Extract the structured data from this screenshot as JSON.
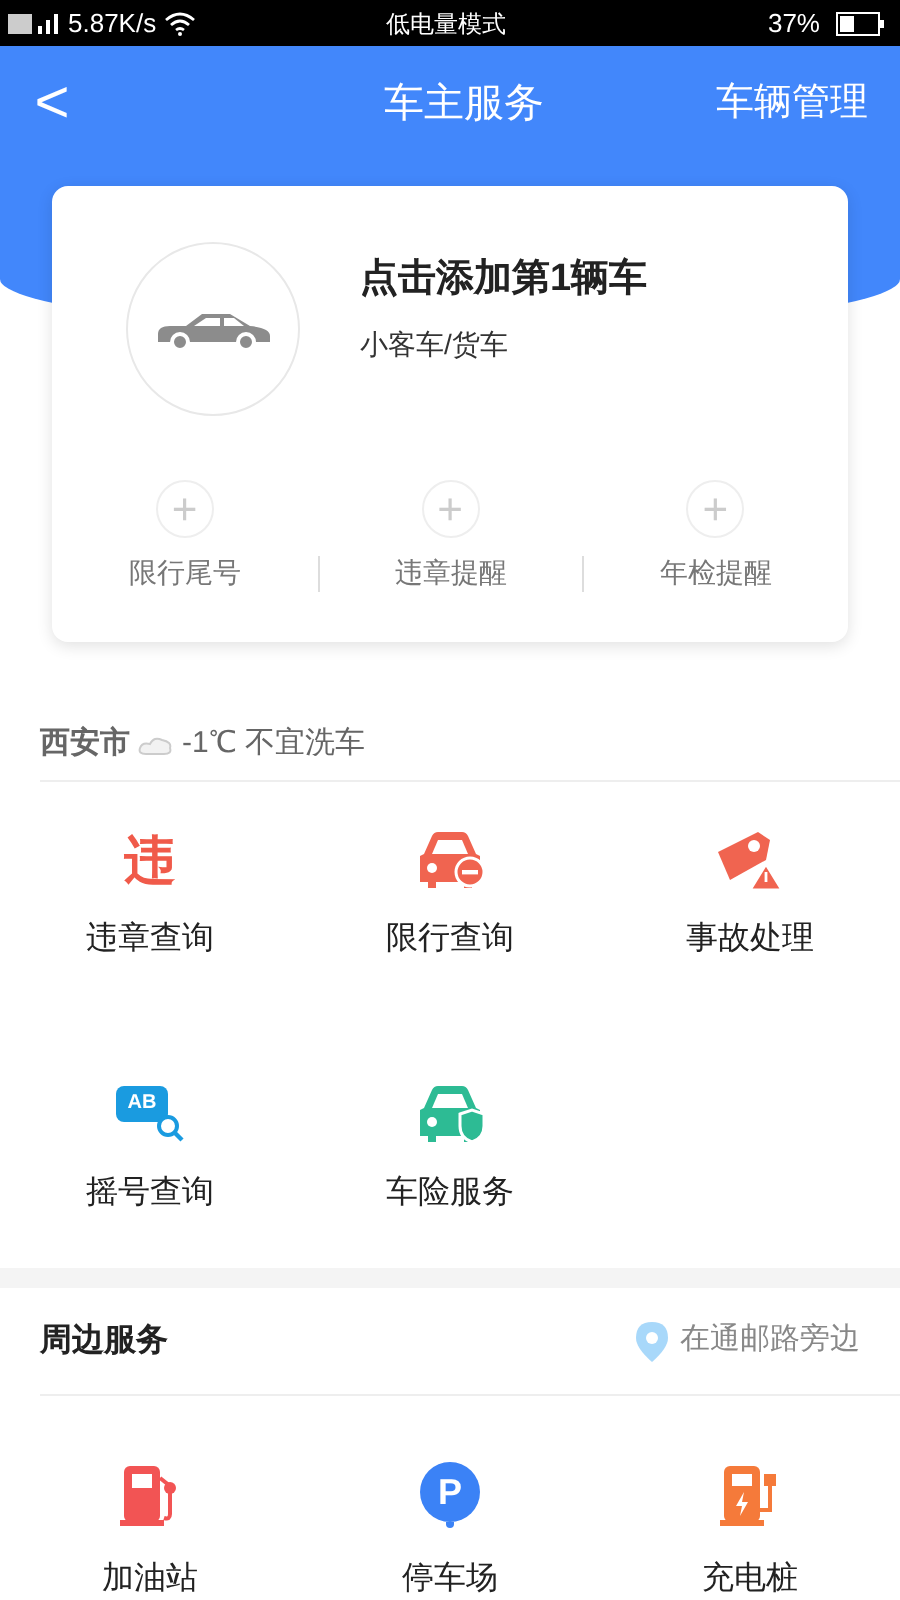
{
  "status_bar": {
    "speed": "5.87K/s",
    "mode": "低电量模式",
    "battery": "37%"
  },
  "header": {
    "back": "<",
    "title": "车主服务",
    "action": "车辆管理"
  },
  "vehicle_card": {
    "title": "点击添加第1辆车",
    "subtitle": "小客车/货车",
    "shortcuts": [
      {
        "plus": "+",
        "label": "限行尾号"
      },
      {
        "plus": "+",
        "label": "违章提醒"
      },
      {
        "plus": "+",
        "label": "年检提醒"
      }
    ]
  },
  "weather": {
    "city": "西安市",
    "temp": "-1℃",
    "advice": "不宜洗车"
  },
  "services": [
    {
      "kind": "violation",
      "glyph": "违",
      "label": "违章查询"
    },
    {
      "kind": "restriction",
      "label": "限行查询"
    },
    {
      "kind": "accident",
      "label": "事故处理"
    },
    {
      "kind": "lottery",
      "glyph": "AB",
      "label": "摇号查询"
    },
    {
      "kind": "insurance",
      "label": "车险服务"
    }
  ],
  "nearby": {
    "title": "周边服务",
    "location": "在通邮路旁边",
    "items": [
      {
        "kind": "fuel",
        "label": "加油站"
      },
      {
        "kind": "parking",
        "glyph": "P",
        "label": "停车场"
      },
      {
        "kind": "charging",
        "label": "充电桩"
      }
    ]
  }
}
